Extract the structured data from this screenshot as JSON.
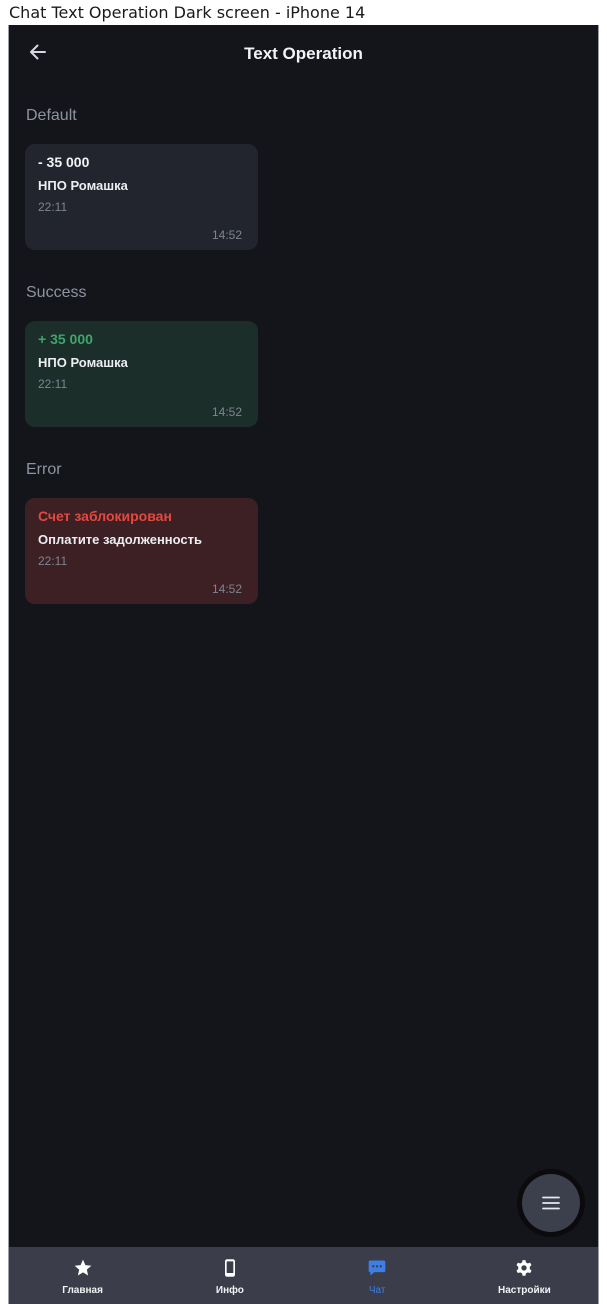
{
  "frame_title": "Chat Text Operation Dark screen - iPhone 14",
  "header": {
    "title": "Text Operation"
  },
  "sections": [
    {
      "label": "Default",
      "bubble": {
        "title": "- 35 000",
        "subtitle": "НПО Ромашка",
        "meta": "22:11",
        "time": "14:52"
      }
    },
    {
      "label": "Success",
      "bubble": {
        "title": "+ 35 000",
        "subtitle": "НПО Ромашка",
        "meta": "22:11",
        "time": "14:52"
      }
    },
    {
      "label": "Error",
      "bubble": {
        "title": "Счет заблокирован",
        "subtitle": "Оплатите задолженность",
        "meta": "22:11",
        "time": "14:52"
      }
    }
  ],
  "tabbar": {
    "items": [
      {
        "label": "Главная",
        "icon": "star-icon",
        "active": false
      },
      {
        "label": "Инфо",
        "icon": "phone-icon",
        "active": false
      },
      {
        "label": "Чат",
        "icon": "chat-icon",
        "active": true
      },
      {
        "label": "Настройки",
        "icon": "gear-icon",
        "active": false
      }
    ]
  },
  "colors": {
    "background": "#14151a",
    "default_bubble": "#23252e",
    "success_bubble": "#1c2e2a",
    "error_bubble": "#3d2024",
    "success_text": "#3fa66a",
    "error_text": "#e5483f",
    "accent": "#3d7fe6",
    "tabbar": "#3b3d4a"
  },
  "fab": {
    "icon": "menu-icon"
  }
}
